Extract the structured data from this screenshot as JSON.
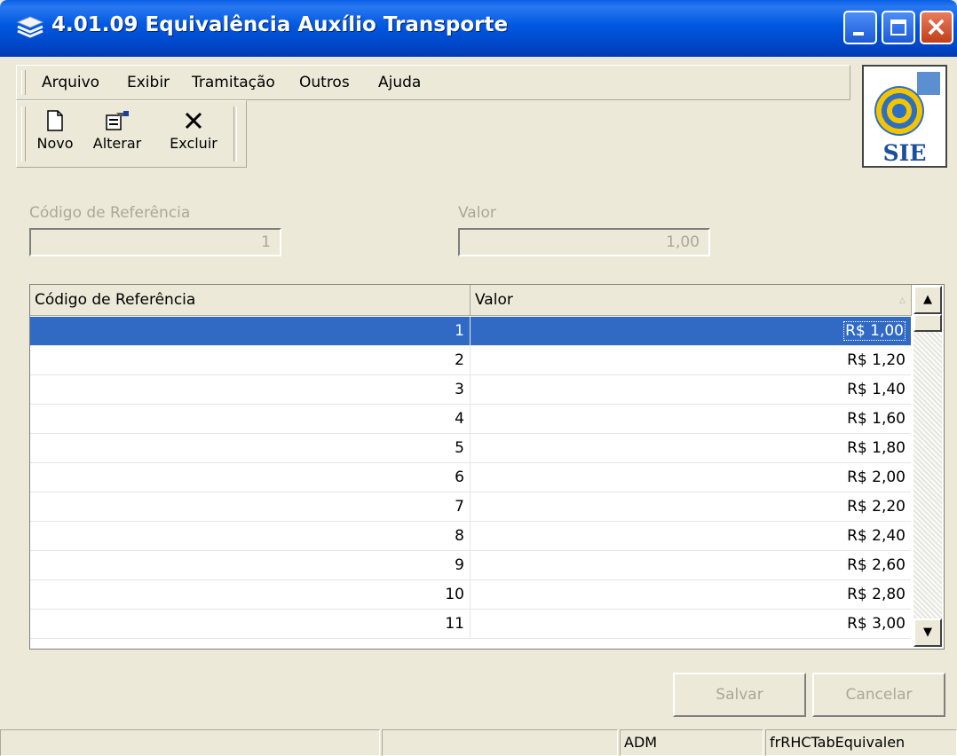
{
  "window": {
    "title": "4.01.09 Equivalência Auxílio Transporte"
  },
  "menu": {
    "items": [
      "Arquivo",
      "Exibir",
      "Tramitação",
      "Outros",
      "Ajuda"
    ]
  },
  "toolbar": {
    "buttons": [
      {
        "label": "Novo",
        "icon": "new-document-icon"
      },
      {
        "label": "Alterar",
        "icon": "edit-properties-icon"
      },
      {
        "label": "Excluir",
        "icon": "delete-x-icon"
      }
    ]
  },
  "logo": {
    "text": "SIE"
  },
  "form": {
    "codigo_label": "Código de Referência",
    "codigo_value": "1",
    "valor_label": "Valor",
    "valor_value": "1,00"
  },
  "grid": {
    "headers": [
      "Código de Referência",
      "Valor"
    ],
    "sort_indicator": "▵",
    "rows": [
      {
        "codigo": "1",
        "valor": "R$ 1,00"
      },
      {
        "codigo": "2",
        "valor": "R$ 1,20"
      },
      {
        "codigo": "3",
        "valor": "R$ 1,40"
      },
      {
        "codigo": "4",
        "valor": "R$ 1,60"
      },
      {
        "codigo": "5",
        "valor": "R$ 1,80"
      },
      {
        "codigo": "6",
        "valor": "R$ 2,00"
      },
      {
        "codigo": "7",
        "valor": "R$ 2,20"
      },
      {
        "codigo": "8",
        "valor": "R$ 2,40"
      },
      {
        "codigo": "9",
        "valor": "R$ 2,60"
      },
      {
        "codigo": "10",
        "valor": "R$ 2,80"
      },
      {
        "codigo": "11",
        "valor": "R$ 3,00"
      }
    ],
    "selected_row": 0
  },
  "actions": {
    "save_label": "Salvar",
    "cancel_label": "Cancelar"
  },
  "statusbar": {
    "panels": [
      "",
      "",
      "ADM",
      "frRHCTabEquivalen"
    ]
  },
  "colors": {
    "title_blue": "#0058e0",
    "selection": "#316ac5",
    "face": "#ece9d8"
  }
}
